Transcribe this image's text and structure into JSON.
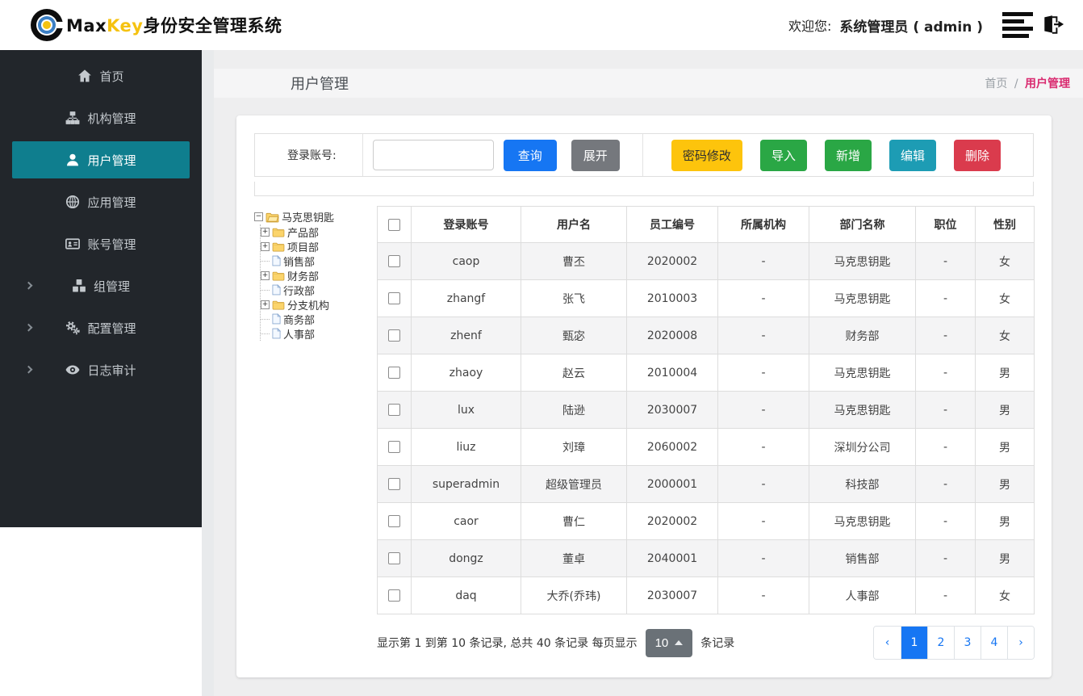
{
  "header": {
    "brand_max": "Max",
    "brand_key": "Key",
    "brand_suffix": "身份安全管理系统",
    "welcome_label": "欢迎您:",
    "user_name": "系统管理员 ( admin )"
  },
  "sidebar": {
    "items": [
      {
        "key": "home",
        "label": "首页",
        "icon": "home-icon",
        "active": false,
        "chevron": false
      },
      {
        "key": "org",
        "label": "机构管理",
        "icon": "sitemap-icon",
        "active": false,
        "chevron": false
      },
      {
        "key": "user",
        "label": "用户管理",
        "icon": "user-icon",
        "active": true,
        "chevron": false
      },
      {
        "key": "app",
        "label": "应用管理",
        "icon": "globe-icon",
        "active": false,
        "chevron": false
      },
      {
        "key": "account",
        "label": "账号管理",
        "icon": "idcard-icon",
        "active": false,
        "chevron": false
      },
      {
        "key": "group",
        "label": "组管理",
        "icon": "cubes-icon",
        "active": false,
        "chevron": true
      },
      {
        "key": "config",
        "label": "配置管理",
        "icon": "gears-icon",
        "active": false,
        "chevron": true
      },
      {
        "key": "audit",
        "label": "日志审计",
        "icon": "eye-icon",
        "active": false,
        "chevron": true
      }
    ]
  },
  "page": {
    "title": "用户管理",
    "breadcrumb_home": "首页",
    "breadcrumb_sep": "/",
    "breadcrumb_current": "用户管理"
  },
  "toolbar": {
    "search_label": "登录账号:",
    "search_value": "",
    "query_label": "查询",
    "expand_label": "展开",
    "actions": [
      {
        "label": "密码修改",
        "color": "warning"
      },
      {
        "label": "导入",
        "color": "success"
      },
      {
        "label": "新增",
        "color": "success"
      },
      {
        "label": "编辑",
        "color": "info"
      },
      {
        "label": "删除",
        "color": "danger"
      }
    ]
  },
  "tree": {
    "root": {
      "label": "马克思钥匙",
      "toggle": "−",
      "icon": "folder-open"
    },
    "children": [
      {
        "label": "产品部",
        "toggle": "+",
        "icon": "folder"
      },
      {
        "label": "项目部",
        "toggle": "+",
        "icon": "folder"
      },
      {
        "label": "销售部",
        "toggle": "",
        "icon": "file"
      },
      {
        "label": "财务部",
        "toggle": "+",
        "icon": "folder"
      },
      {
        "label": "行政部",
        "toggle": "",
        "icon": "file"
      },
      {
        "label": "分支机构",
        "toggle": "+",
        "icon": "folder"
      },
      {
        "label": "商务部",
        "toggle": "",
        "icon": "file"
      },
      {
        "label": "人事部",
        "toggle": "",
        "icon": "file"
      }
    ]
  },
  "table": {
    "headers": [
      "登录账号",
      "用户名",
      "员工编号",
      "所属机构",
      "部门名称",
      "职位",
      "性别"
    ],
    "rows": [
      [
        "caop",
        "曹丕",
        "2020002",
        "-",
        "马克思钥匙",
        "-",
        "女"
      ],
      [
        "zhangf",
        "张飞",
        "2010003",
        "-",
        "马克思钥匙",
        "-",
        "女"
      ],
      [
        "zhenf",
        "甄宓",
        "2020008",
        "-",
        "财务部",
        "-",
        "女"
      ],
      [
        "zhaoy",
        "赵云",
        "2010004",
        "-",
        "马克思钥匙",
        "-",
        "男"
      ],
      [
        "lux",
        "陆逊",
        "2030007",
        "-",
        "马克思钥匙",
        "-",
        "男"
      ],
      [
        "liuz",
        "刘璋",
        "2060002",
        "-",
        "深圳分公司",
        "-",
        "男"
      ],
      [
        "superadmin",
        "超级管理员",
        "2000001",
        "-",
        "科技部",
        "-",
        "男"
      ],
      [
        "caor",
        "曹仁",
        "2020002",
        "-",
        "马克思钥匙",
        "-",
        "男"
      ],
      [
        "dongz",
        "董卓",
        "2040001",
        "-",
        "销售部",
        "-",
        "男"
      ],
      [
        "daq",
        "大乔(乔玮)",
        "2030007",
        "-",
        "人事部",
        "-",
        "女"
      ]
    ]
  },
  "pagination": {
    "summary_prefix": "显示第 1 到第 10 条记录, 总共 40 条记录  每页显示",
    "page_size": "10",
    "summary_suffix": "条记录",
    "pages": [
      "‹",
      "1",
      "2",
      "3",
      "4",
      "›"
    ],
    "active_page": "1"
  },
  "colors": {
    "sidebar_bg": "#22262b",
    "sidebar_active": "#0f7e8e",
    "primary_blue": "#1676f3",
    "brand_yellow": "#f5c211",
    "warning": "#fdc40c",
    "success": "#2aa745",
    "info": "#1d9cb4",
    "danger": "#da3b4d",
    "breadcrumb_active": "#d92a6f"
  }
}
